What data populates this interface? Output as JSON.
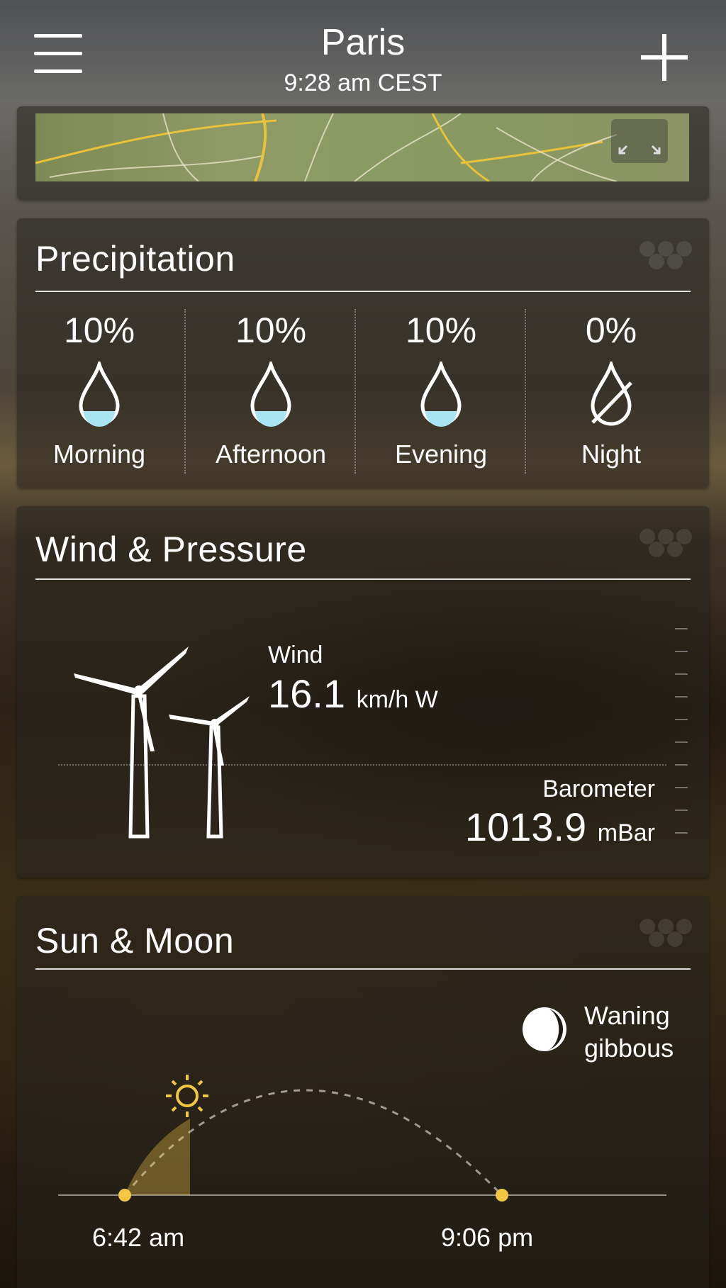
{
  "header": {
    "city": "Paris",
    "time": "9:28 am CEST",
    "menu_icon": "hamburger-menu-icon",
    "add_icon": "plus-icon"
  },
  "map": {
    "expand_icon": "expand-arrows-icon"
  },
  "precipitation": {
    "title": "Precipitation",
    "periods": [
      {
        "label": "Morning",
        "chance": "10%",
        "icon": "raindrop-icon"
      },
      {
        "label": "Afternoon",
        "chance": "10%",
        "icon": "raindrop-icon"
      },
      {
        "label": "Evening",
        "chance": "10%",
        "icon": "raindrop-icon"
      },
      {
        "label": "Night",
        "chance": "0%",
        "icon": "no-rain-icon"
      }
    ]
  },
  "wind_pressure": {
    "title": "Wind & Pressure",
    "wind_label": "Wind",
    "wind_speed": "16.1",
    "wind_unit": "km/h W",
    "barometer_label": "Barometer",
    "barometer_value": "1013.9",
    "barometer_unit": "mBar",
    "icon": "wind-turbine-icon"
  },
  "sun_moon": {
    "title": "Sun & Moon",
    "moon_phase_line1": "Waning",
    "moon_phase_line2": "gibbous",
    "sunrise": "6:42 am",
    "sunset": "9:06 pm",
    "sun_icon": "sun-icon",
    "moon_icon": "moon-phase-icon"
  },
  "colors": {
    "accent": "#f2c744",
    "text": "#ffffff"
  }
}
